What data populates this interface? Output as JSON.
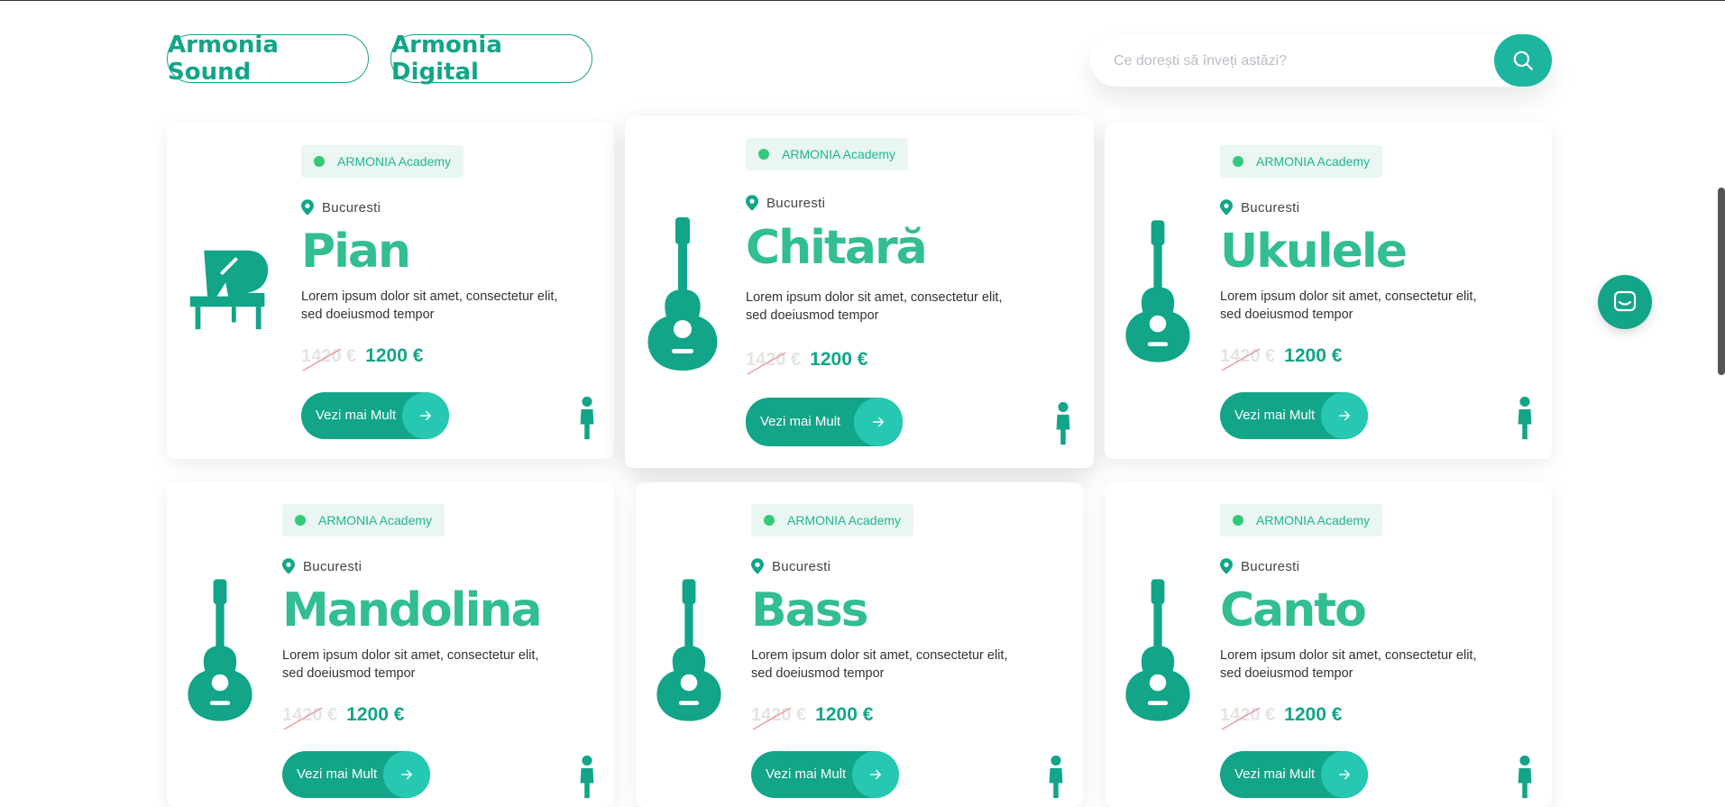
{
  "nav": {
    "tabs": [
      "Armonia Sound",
      "Armonia Digital"
    ]
  },
  "search": {
    "placeholder": "Ce dorești să înveți astăzi?",
    "value": ""
  },
  "brand_color": "#12a588",
  "courses": [
    {
      "badge": "ARMONIA Academy",
      "location": "Bucuresti",
      "title": "Pian",
      "description": "Lorem ipsum dolor sit amet, consectetur elit, sed doeiusmod tempor",
      "old_price": "1420 €",
      "price": "1200 €",
      "button": "Vezi mai Mult",
      "icon": "piano-icon"
    },
    {
      "badge": "ARMONIA Academy",
      "location": "Bucuresti",
      "title": "Chitară",
      "description": "Lorem ipsum dolor sit amet, consectetur elit, sed doeiusmod tempor",
      "old_price": "1420 €",
      "price": "1200 €",
      "button": "Vezi mai Mult",
      "icon": "guitar-icon"
    },
    {
      "badge": "ARMONIA Academy",
      "location": "Bucuresti",
      "title": "Ukulele",
      "description": "Lorem ipsum dolor sit amet, consectetur elit, sed doeiusmod tempor",
      "old_price": "1420 €",
      "price": "1200 €",
      "button": "Vezi mai Mult",
      "icon": "guitar-icon"
    },
    {
      "badge": "ARMONIA Academy",
      "location": "Bucuresti",
      "title": "Mandolina",
      "description": "Lorem ipsum dolor sit amet, consectetur elit, sed doeiusmod tempor",
      "old_price": "1420 €",
      "price": "1200 €",
      "button": "Vezi mai Mult",
      "icon": "guitar-icon"
    },
    {
      "badge": "ARMONIA Academy",
      "location": "Bucuresti",
      "title": "Bass",
      "description": "Lorem ipsum dolor sit amet, consectetur elit, sed doeiusmod tempor",
      "old_price": "1420 €",
      "price": "1200 €",
      "button": "Vezi mai Mult",
      "icon": "guitar-icon"
    },
    {
      "badge": "ARMONIA Academy",
      "location": "Bucuresti",
      "title": "Canto",
      "description": "Lorem ipsum dolor sit amet, consectetur elit, sed doeiusmod tempor",
      "old_price": "1420 €",
      "price": "1200 €",
      "button": "Vezi mai Mult",
      "icon": "guitar-icon"
    }
  ]
}
